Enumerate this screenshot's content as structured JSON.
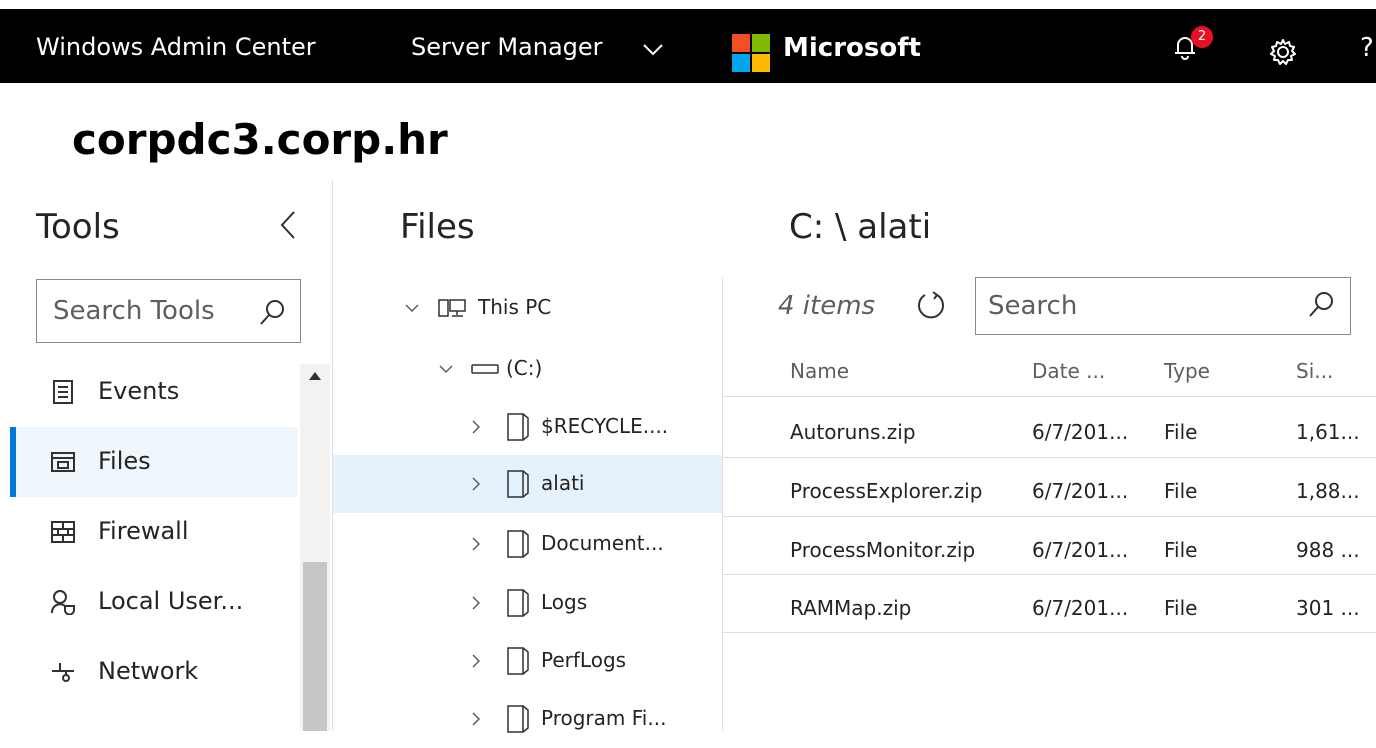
{
  "topbar": {
    "app_title": "Windows Admin Center",
    "context_switcher": "Server Manager",
    "brand_name": "Microsoft",
    "brand_colors": [
      "#f25022",
      "#7fba00",
      "#00a4ef",
      "#ffb900"
    ],
    "notification_count": "2",
    "help_glyph": "?"
  },
  "page": {
    "title": "corpdc3.corp.hr"
  },
  "tools": {
    "heading": "Tools",
    "search_placeholder": "Search Tools",
    "items": [
      {
        "label": "Events",
        "icon": "events-icon",
        "active": false
      },
      {
        "label": "Files",
        "icon": "files-icon",
        "active": true
      },
      {
        "label": "Firewall",
        "icon": "firewall-icon",
        "active": false
      },
      {
        "label": "Local User...",
        "icon": "local-users-icon",
        "active": false
      },
      {
        "label": "Network",
        "icon": "network-icon",
        "active": false
      }
    ]
  },
  "files": {
    "heading": "Files",
    "tree": [
      {
        "label": "This PC",
        "level": 0,
        "expanded": true,
        "icon": "computer-icon"
      },
      {
        "label": "(C:)",
        "level": 1,
        "expanded": true,
        "icon": "drive-icon"
      },
      {
        "label": "$RECYCLE....",
        "level": 2,
        "expanded": false,
        "icon": "folder-icon"
      },
      {
        "label": "alati",
        "level": 2,
        "expanded": false,
        "icon": "folder-icon",
        "selected": true
      },
      {
        "label": "Document...",
        "level": 2,
        "expanded": false,
        "icon": "folder-icon"
      },
      {
        "label": "Logs",
        "level": 2,
        "expanded": false,
        "icon": "folder-icon"
      },
      {
        "label": "PerfLogs",
        "level": 2,
        "expanded": false,
        "icon": "folder-icon"
      },
      {
        "label": "Program Fi...",
        "level": 2,
        "expanded": false,
        "icon": "folder-icon"
      }
    ]
  },
  "listing": {
    "path": "C: \\ alati",
    "count_label": "4 items",
    "search_placeholder": "Search",
    "columns": [
      "Name",
      "Date ...",
      "Type",
      "Si..."
    ],
    "rows": [
      [
        "Autoruns.zip",
        "6/7/201...",
        "File",
        "1,61..."
      ],
      [
        "ProcessExplorer.zip",
        "6/7/201...",
        "File",
        "1,88..."
      ],
      [
        "ProcessMonitor.zip",
        "6/7/201...",
        "File",
        "988 ..."
      ],
      [
        "RAMMap.zip",
        "6/7/201...",
        "File",
        "301 ..."
      ]
    ]
  },
  "theme": {
    "accent": "#0078d4",
    "topbar_bg": "#000000",
    "badge": "#e81123"
  }
}
